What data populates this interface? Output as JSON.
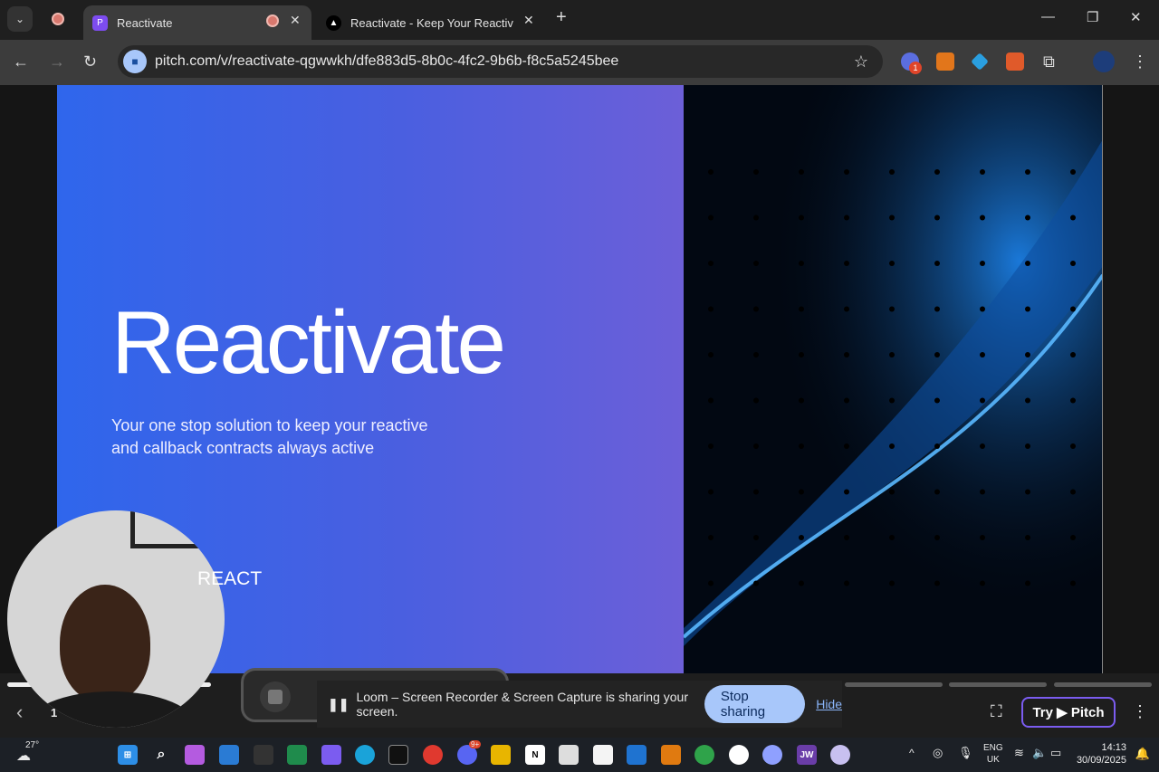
{
  "browser": {
    "tabs": [
      {
        "label": "Reactivate",
        "active": true
      },
      {
        "label": "Reactivate - Keep Your Reactive",
        "active": false
      }
    ],
    "url": "pitch.com/v/reactivate-qgwwkh/dfe883d5-8b0c-4fc2-9b6b-f8c5a5245bee",
    "extension_badge": "1"
  },
  "slide": {
    "title": "Reactivate",
    "subtitle": "Your one stop solution to keep your reactive and callback contracts always active",
    "footer_label": "REACT",
    "page_indicator": "1",
    "colors": {
      "gradient_start": "#2f66ec",
      "gradient_end": "#6c5fd8",
      "dark_panel": "#020812"
    }
  },
  "player": {
    "try_label": "Try",
    "brand_label": "Pitch"
  },
  "loom": {
    "message": "Loom – Screen Recorder & Screen Capture is sharing your screen.",
    "stop_label": "Stop sharing",
    "hide_label": "Hide"
  },
  "taskbar": {
    "weather": "27°",
    "lang": "ENG",
    "region": "UK",
    "time": "14:13",
    "date": "30/09/2025",
    "discord_badge": "9+"
  }
}
